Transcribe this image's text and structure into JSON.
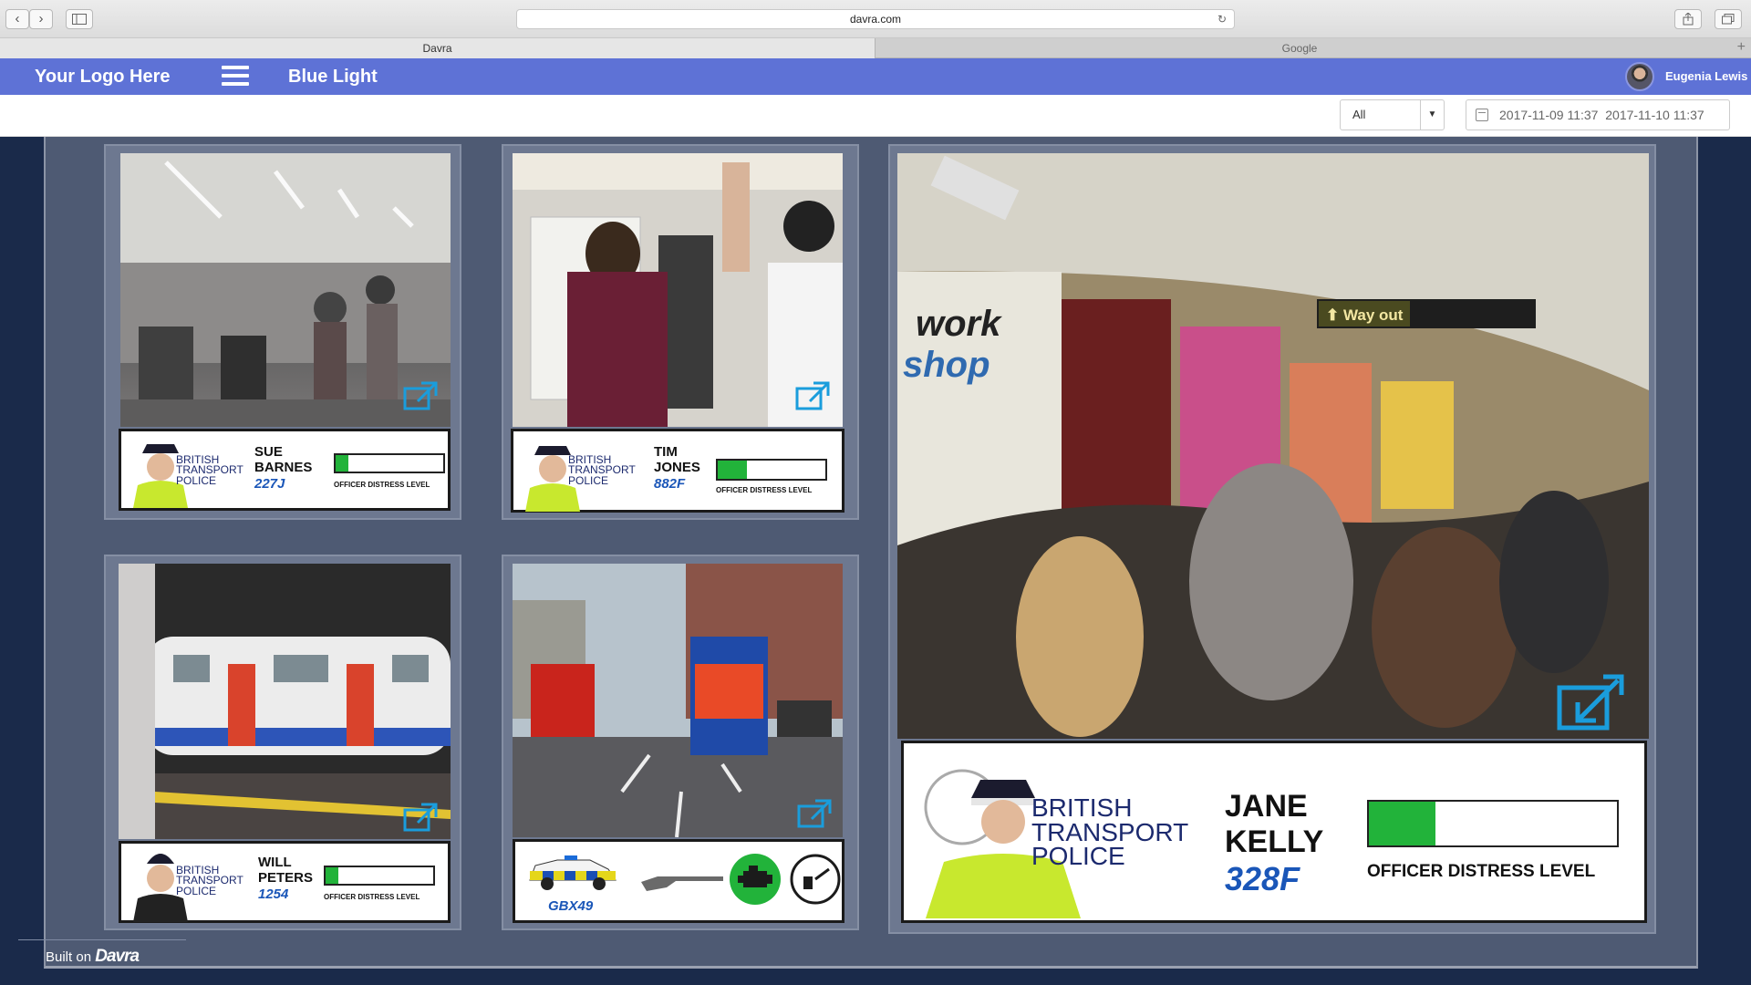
{
  "browser": {
    "url": "davra.com",
    "tabs": [
      {
        "label": "Davra",
        "active": true
      },
      {
        "label": "Google",
        "active": false
      }
    ],
    "nav": {
      "back_icon": "chevron-left-icon",
      "forward_icon": "chevron-right-icon",
      "sidebar_icon": "sidebar-icon",
      "reload_icon": "reload-icon",
      "share_icon": "share-icon",
      "tabs_icon": "tabs-icon",
      "new_tab_label": "+"
    }
  },
  "header": {
    "logo": "Your Logo Here",
    "title": "Blue Light",
    "user_name": "Eugenia Lewis",
    "accent_color": "#5e72d6"
  },
  "filters": {
    "select_value": "All",
    "date_from": "2017-11-09  11:37",
    "date_to": "2017-11-10  11:37"
  },
  "cards": [
    {
      "org": [
        "BRITISH",
        "TRANSPORT",
        "POLICE"
      ],
      "first": "SUE",
      "last": "BARNES",
      "id": "227J",
      "meter_label": "OFFICER DISTRESS LEVEL",
      "distress_fraction": 0.12
    },
    {
      "org": [
        "BRITISH",
        "TRANSPORT",
        "POLICE"
      ],
      "first": "TIM",
      "last": "JONES",
      "id": "882F",
      "meter_label": "OFFICER DISTRESS LEVEL",
      "distress_fraction": 0.27
    },
    {
      "org": [
        "BRITISH",
        "TRANSPORT",
        "POLICE"
      ],
      "first": "WILL",
      "last": "PETERS",
      "id": "1254",
      "meter_label": "OFFICER DISTRESS LEVEL",
      "distress_fraction": 0.12
    },
    {
      "org": [
        "BRITISH",
        "TRANSPORT",
        "POLICE"
      ],
      "first": "JANE",
      "last": "KELLY",
      "id": "328F",
      "meter_label": "OFFICER DISTRESS LEVEL",
      "distress_fraction": 0.27
    }
  ],
  "vehicle": {
    "reg": "GBX49"
  },
  "footer": {
    "built_on": "Built on",
    "brand": "Davra"
  },
  "status_colors": {
    "distress": "#22b33a",
    "engine_ok": "#22b33a"
  }
}
